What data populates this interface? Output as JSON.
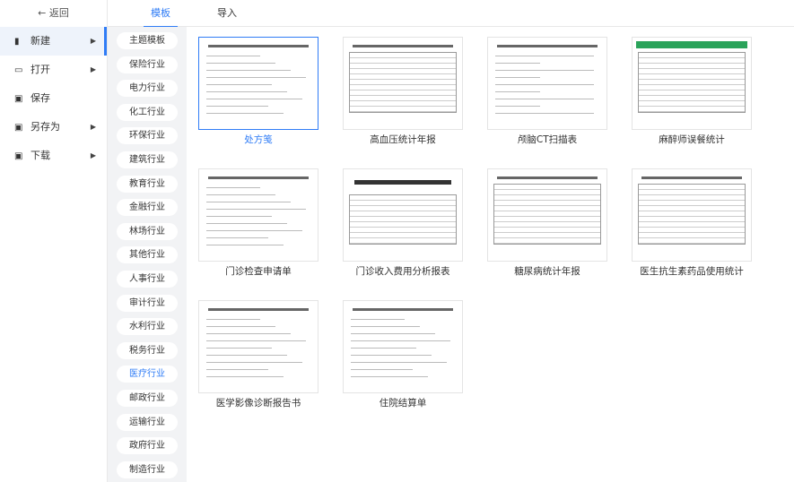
{
  "sidebar": {
    "back": "← 返回",
    "items": [
      {
        "label": "新建",
        "icon": "new-file-icon",
        "glyph": "▮",
        "arrow": "▶",
        "active": true
      },
      {
        "label": "打开",
        "icon": "folder-icon",
        "glyph": "▭",
        "arrow": "▶",
        "active": false
      },
      {
        "label": "保存",
        "icon": "save-icon",
        "glyph": "▣",
        "arrow": "",
        "active": false
      },
      {
        "label": "另存为",
        "icon": "save-as-icon",
        "glyph": "▣",
        "arrow": "▶",
        "active": false
      },
      {
        "label": "下载",
        "icon": "download-icon",
        "glyph": "▣",
        "arrow": "▶",
        "active": false
      }
    ]
  },
  "tabs": [
    {
      "label": "模板",
      "active": true
    },
    {
      "label": "导入",
      "active": false
    }
  ],
  "categories": [
    "主题模板",
    "保险行业",
    "电力行业",
    "化工行业",
    "环保行业",
    "建筑行业",
    "教育行业",
    "金融行业",
    "林场行业",
    "其他行业",
    "人事行业",
    "审计行业",
    "水利行业",
    "税务行业",
    "医疗行业",
    "邮政行业",
    "运输行业",
    "政府行业",
    "制造行业"
  ],
  "active_category": "医疗行业",
  "templates": [
    {
      "name": "处方笺",
      "thumb": "form",
      "selected": true
    },
    {
      "name": "高血压统计年报",
      "thumb": "table",
      "selected": false
    },
    {
      "name": "颅脑CT扫描表",
      "thumb": "sparse",
      "selected": false
    },
    {
      "name": "麻醉师误餐统计",
      "thumb": "green",
      "selected": false
    },
    {
      "name": "门诊检查申请单",
      "thumb": "form",
      "selected": false
    },
    {
      "name": "门诊收入费用分析报表",
      "thumb": "bold",
      "selected": false
    },
    {
      "name": "糖尿病统计年报",
      "thumb": "table",
      "selected": false
    },
    {
      "name": "医生抗生素药品使用统计",
      "thumb": "table",
      "selected": false
    },
    {
      "name": "医学影像诊断报告书",
      "thumb": "form",
      "selected": false
    },
    {
      "name": "住院结算单",
      "thumb": "form",
      "selected": false
    }
  ],
  "colors": {
    "accent": "#2f7cf6",
    "category_bg": "#f2f3f5",
    "thumb_green": "#2aa35a"
  }
}
